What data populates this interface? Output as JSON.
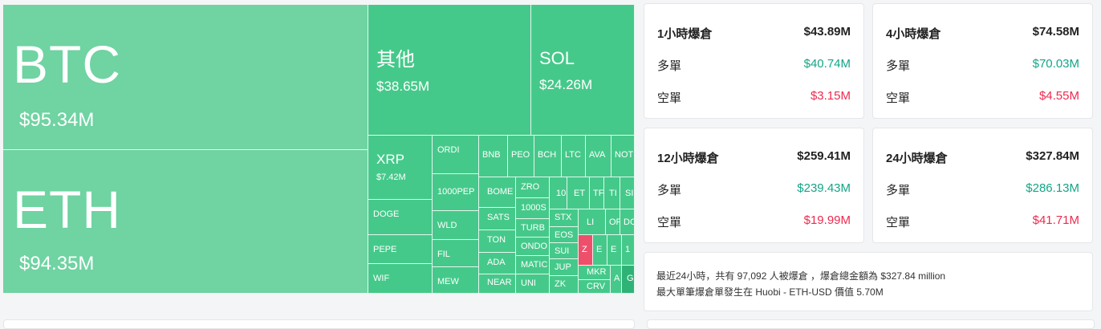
{
  "treemap": {
    "btc": {
      "symbol": "BTC",
      "value": "$95.34M"
    },
    "eth": {
      "symbol": "ETH",
      "value": "$94.35M"
    },
    "other": {
      "symbol": "其他",
      "value": "$38.65M"
    },
    "sol": {
      "symbol": "SOL",
      "value": "$24.26M"
    },
    "xrp": {
      "symbol": "XRP",
      "value": "$7.42M"
    },
    "tiles": [
      "ORDI",
      "BNB",
      "PEO",
      "BCH",
      "LTC",
      "AVA",
      "NOT",
      "1000PEP",
      "BOME",
      "ZRO",
      "10",
      "ET",
      "TF",
      "TI",
      "SI",
      "DOGE",
      "WLD",
      "SATS",
      "1000S",
      "STX",
      "LI",
      "OF",
      "DC",
      "TURB",
      "EOS",
      "TON",
      "PEPE",
      "FIL",
      "ONDO",
      "SUI",
      "Z",
      "E",
      "E",
      "1",
      "ADA",
      "MATIC",
      "JUP",
      "WIF",
      "MEW",
      "NEAR",
      "UNI",
      "ZK",
      "MKR",
      "CRV",
      "A",
      "G"
    ]
  },
  "cards": {
    "h1": {
      "title": "1小時爆倉",
      "total": "$43.89M",
      "long_label": "多單",
      "long": "$40.74M",
      "short_label": "空單",
      "short": "$3.15M"
    },
    "h4": {
      "title": "4小時爆倉",
      "total": "$74.58M",
      "long_label": "多單",
      "long": "$70.03M",
      "short_label": "空單",
      "short": "$4.55M"
    },
    "h12": {
      "title": "12小時爆倉",
      "total": "$259.41M",
      "long_label": "多單",
      "long": "$239.43M",
      "short_label": "空單",
      "short": "$19.99M"
    },
    "h24": {
      "title": "24小時爆倉",
      "total": "$327.84M",
      "long_label": "多單",
      "long": "$286.13M",
      "short_label": "空單",
      "short": "$41.71M"
    }
  },
  "summary": {
    "line1": "最近24小時，共有 97,092 人被爆倉 ，爆倉總金額為 $327.84 million",
    "line2": "最大單筆爆倉單發生在 Huobi - ETH-USD 價值 5.70M"
  },
  "colors": {
    "tile_green": "#45c98a",
    "tile_light": "#6fd3a2",
    "tile_red": "#ee4f6b",
    "long": "#14a587",
    "short": "#ee2a4f"
  }
}
